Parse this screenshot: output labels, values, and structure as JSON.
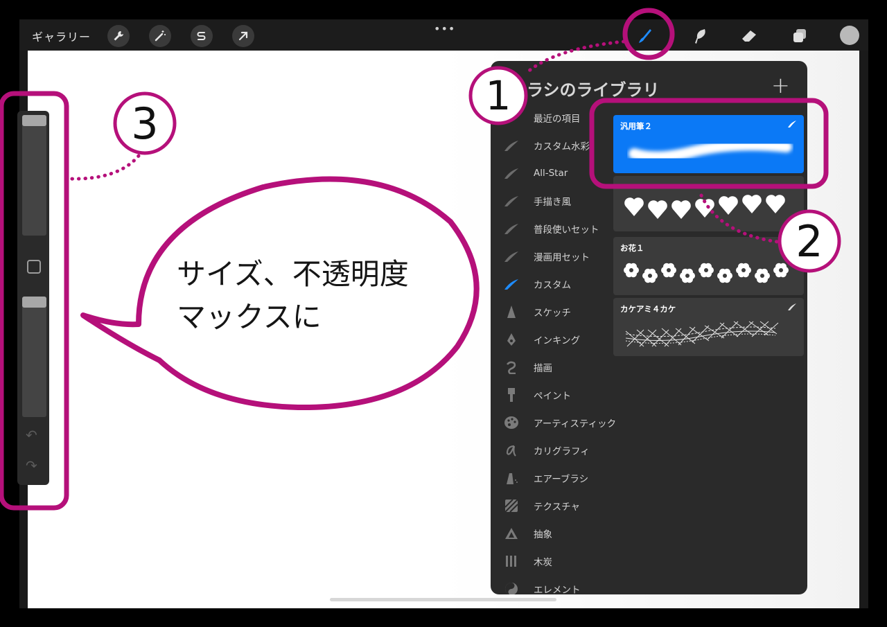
{
  "topbar": {
    "gallery_label": "ギャラリー",
    "more_dots": "•••",
    "left_tools": [
      "wrench-icon",
      "magic-wand-icon",
      "selection-s-icon",
      "arrow-move-icon"
    ],
    "right_tools": [
      "brush-icon",
      "smudge-icon",
      "eraser-icon",
      "layers-icon"
    ],
    "active_color": "#b9b9b9",
    "accent_color": "#0b79f6"
  },
  "sidebar": {
    "size_slider_value_pct": 100,
    "opacity_slider_value_pct": 100,
    "undo_glyph": "↶",
    "redo_glyph": "↷"
  },
  "brush_library": {
    "title": "ラシのライブラリ",
    "add_label": "+",
    "categories": [
      {
        "label": "最近の項目",
        "icon": "none"
      },
      {
        "label": "カスタム水彩",
        "icon": "stroke"
      },
      {
        "label": "All-Star",
        "icon": "stroke"
      },
      {
        "label": "手描き風",
        "icon": "stroke"
      },
      {
        "label": "普段使いセット",
        "icon": "stroke"
      },
      {
        "label": "漫画用セット",
        "icon": "stroke"
      },
      {
        "label": "カスタム",
        "icon": "stroke-blue"
      },
      {
        "label": "スケッチ",
        "icon": "pencil"
      },
      {
        "label": "インキング",
        "icon": "pen-nib"
      },
      {
        "label": "描画",
        "icon": "curl"
      },
      {
        "label": "ペイント",
        "icon": "paint-brush"
      },
      {
        "label": "アーティスティック",
        "icon": "palette"
      },
      {
        "label": "カリグラフィ",
        "icon": "calligraphy"
      },
      {
        "label": "エアーブラシ",
        "icon": "airbrush"
      },
      {
        "label": "テクスチャ",
        "icon": "texture"
      },
      {
        "label": "抽象",
        "icon": "triangle"
      },
      {
        "label": "木炭",
        "icon": "charcoal"
      },
      {
        "label": "エレメント",
        "icon": "yin-yang"
      }
    ],
    "brushes": [
      {
        "name": "汎用筆２",
        "selected": true
      },
      {
        "name": "",
        "selected": false
      },
      {
        "name": "お花１",
        "selected": false
      },
      {
        "name": "カケアミ４カケ",
        "selected": false
      }
    ]
  },
  "annotations": {
    "marker_1": "1",
    "marker_2": "2",
    "marker_3": "3",
    "callout_line1": "サイズ、不透明度",
    "callout_line2": "マックスに",
    "highlight_color": "#b5107a"
  }
}
